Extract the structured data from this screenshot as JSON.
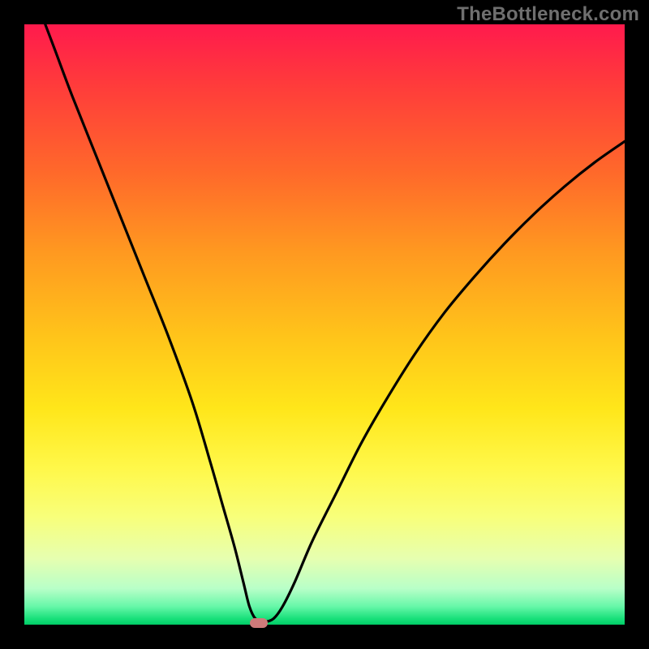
{
  "watermark": "TheBottleneck.com",
  "chart_data": {
    "type": "line",
    "title": "",
    "xlabel": "",
    "ylabel": "",
    "xlim": [
      0,
      100
    ],
    "ylim": [
      0,
      100
    ],
    "grid": false,
    "legend": false,
    "series": [
      {
        "name": "bottleneck-curve",
        "x": [
          0,
          2,
          5,
          8,
          12,
          16,
          20,
          24,
          28,
          31,
          33,
          35,
          36.5,
          37.5,
          38.5,
          40,
          41.5,
          43,
          45,
          48,
          52,
          56,
          60,
          65,
          70,
          75,
          80,
          85,
          90,
          95,
          100
        ],
        "y": [
          110,
          104,
          96,
          88,
          78,
          68,
          58,
          48,
          37,
          27,
          20,
          13,
          7,
          3,
          1,
          0.5,
          1,
          3,
          7,
          14,
          22,
          30,
          37,
          45,
          52,
          58,
          63.5,
          68.5,
          73,
          77,
          80.5
        ]
      }
    ],
    "marker": {
      "x_pct": 39.0,
      "y_pct": 0.3,
      "color": "#cf7a7a"
    },
    "gradient_stops": [
      {
        "pct": 0,
        "color": "#ff1a4d"
      },
      {
        "pct": 25,
        "color": "#ff6a2a"
      },
      {
        "pct": 52,
        "color": "#ffc41a"
      },
      {
        "pct": 74,
        "color": "#fff84a"
      },
      {
        "pct": 94,
        "color": "#b8ffc8"
      },
      {
        "pct": 100,
        "color": "#00cc66"
      }
    ]
  }
}
